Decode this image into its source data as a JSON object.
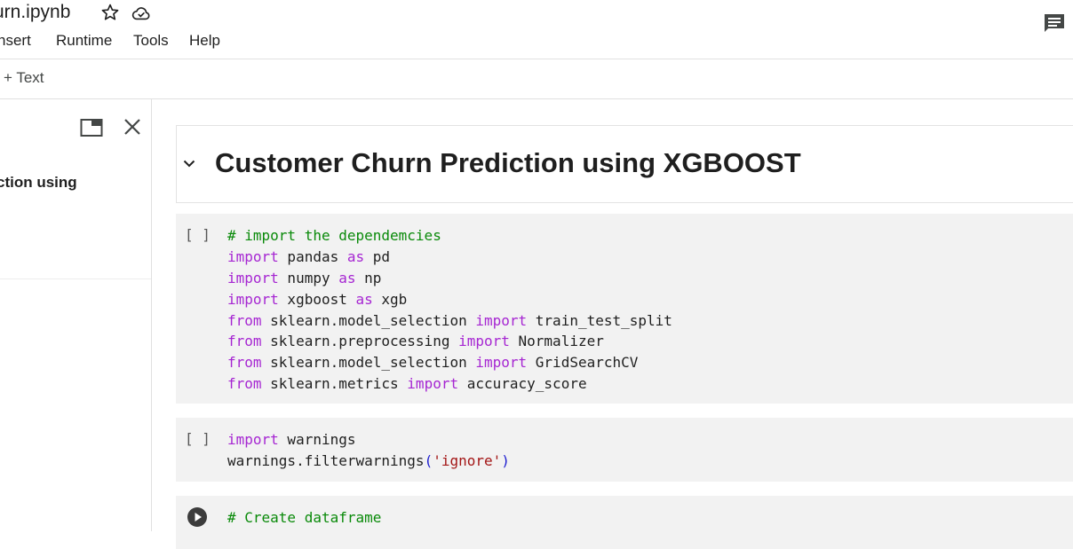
{
  "header": {
    "notebook_title": "urn.ipynb",
    "menu": [
      "nsert",
      "Runtime",
      "Tools",
      "Help"
    ],
    "add_text_label": "+ Text"
  },
  "side_panel": {
    "toc_item": "ction using"
  },
  "cells": {
    "heading": "Customer Churn Prediction using XGBOOST",
    "run_placeholder": "[ ]",
    "cell1": [
      [
        {
          "t": "# import the dependemcies",
          "c": "cm"
        }
      ],
      [
        {
          "t": "import",
          "c": "kw"
        },
        {
          "t": " pandas "
        },
        {
          "t": "as",
          "c": "kw"
        },
        {
          "t": " pd"
        }
      ],
      [
        {
          "t": "import",
          "c": "kw"
        },
        {
          "t": " numpy "
        },
        {
          "t": "as",
          "c": "kw"
        },
        {
          "t": " np"
        }
      ],
      [
        {
          "t": "import",
          "c": "kw"
        },
        {
          "t": " xgboost "
        },
        {
          "t": "as",
          "c": "kw"
        },
        {
          "t": " xgb"
        }
      ],
      [
        {
          "t": "from",
          "c": "kw"
        },
        {
          "t": " sklearn.model_selection "
        },
        {
          "t": "import",
          "c": "kw"
        },
        {
          "t": " train_test_split"
        }
      ],
      [
        {
          "t": "from",
          "c": "kw"
        },
        {
          "t": " sklearn.preprocessing "
        },
        {
          "t": "import",
          "c": "kw"
        },
        {
          "t": " Normalizer"
        }
      ],
      [
        {
          "t": "from",
          "c": "kw"
        },
        {
          "t": " sklearn.model_selection "
        },
        {
          "t": "import",
          "c": "kw"
        },
        {
          "t": " GridSearchCV"
        }
      ],
      [
        {
          "t": "from",
          "c": "kw"
        },
        {
          "t": " sklearn.metrics "
        },
        {
          "t": "import",
          "c": "kw"
        },
        {
          "t": " accuracy_score"
        }
      ]
    ],
    "cell2": [
      [
        {
          "t": "import",
          "c": "kw"
        },
        {
          "t": " warnings"
        }
      ],
      [
        {
          "t": "warnings.filterwarnings"
        },
        {
          "t": "(",
          "c": "pn"
        },
        {
          "t": "'ignore'",
          "c": "st"
        },
        {
          "t": ")",
          "c": "pn"
        }
      ]
    ],
    "cell3": [
      [
        {
          "t": "# Create dataframe",
          "c": "cm"
        }
      ]
    ]
  },
  "icons": {
    "star": "star-outline-icon",
    "cloud": "cloud-saved-icon",
    "comment": "comment-icon",
    "panel": "open-in-tab-icon",
    "close": "close-icon",
    "collapse": "chevron-down-icon",
    "run": "play-circle-icon"
  }
}
